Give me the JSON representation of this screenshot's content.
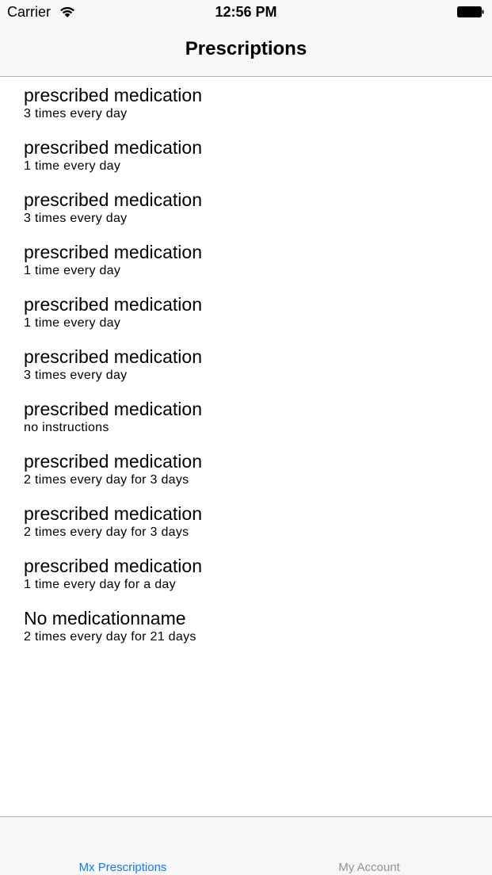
{
  "status_bar": {
    "carrier": "Carrier",
    "time": "12:56 PM",
    "wifi_icon": "wifi-icon",
    "battery_icon": "battery-icon"
  },
  "nav": {
    "title": "Prescriptions"
  },
  "prescriptions": [
    {
      "name": "prescribed medication",
      "detail": "3 times every day"
    },
    {
      "name": "prescribed medication",
      "detail": "1 time every day"
    },
    {
      "name": "prescribed medication",
      "detail": "3 times every day"
    },
    {
      "name": "prescribed medication",
      "detail": "1 time every day"
    },
    {
      "name": "prescribed medication",
      "detail": "1 time every day"
    },
    {
      "name": "prescribed medication",
      "detail": "3 times every day"
    },
    {
      "name": "prescribed medication",
      "detail": "no instructions"
    },
    {
      "name": "prescribed medication",
      "detail": "2 times every day for 3 days"
    },
    {
      "name": "prescribed medication",
      "detail": "2 times every day for 3 days"
    },
    {
      "name": "prescribed medication",
      "detail": "1 time every day for a day"
    },
    {
      "name": "No medicationname",
      "detail": "2 times every day for 21 days"
    }
  ],
  "tabbar": {
    "tabs": [
      {
        "label": "Mx Prescriptions",
        "active": true
      },
      {
        "label": "My Account",
        "active": false
      }
    ],
    "active_color": "#0f7aff",
    "inactive_color": "#929292"
  }
}
